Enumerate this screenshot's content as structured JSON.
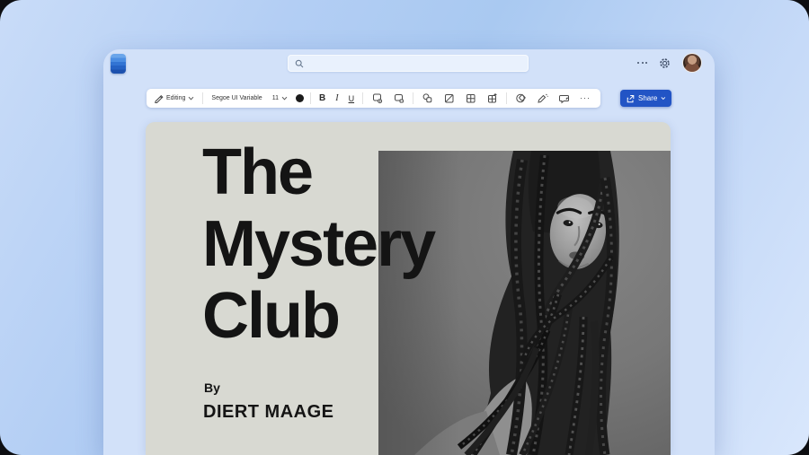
{
  "window": {
    "topbar": {
      "search": {
        "placeholder": "",
        "icon": "search-icon"
      },
      "right_icons": [
        "more-horizontal-icon",
        "settings-gear-icon",
        "user-avatar"
      ]
    },
    "toolbar": {
      "mode_label": "Editing",
      "font_family": "Segoe UI Variable",
      "font_size": "11",
      "text_color_swatch": "#1b1b1b",
      "bold_label": "B",
      "italic_label": "I",
      "underline_label": "U",
      "more_glyph": "···",
      "icons": [
        "pencil-icon",
        "chevron-down-icon",
        "styles-icon",
        "format-painter-icon",
        "shapes-icon",
        "image-icon",
        "table-icon",
        "table-add-icon",
        "designer-icon",
        "ink-pen-icon",
        "comments-icon",
        "more-options-icon"
      ]
    },
    "share": {
      "label": "Share",
      "color": "#2254C5",
      "icon": "share-icon"
    }
  },
  "document": {
    "background": "#D8D9D2",
    "title_lines": [
      "The",
      "Mystery",
      "Club"
    ],
    "byline_prefix": "By",
    "author": "DIERT MAAGE",
    "photo_description": "grayscale portrait of woman with long braids"
  },
  "colors": {
    "desktop_gradient": [
      "#C9DCF8",
      "#A9C9F1",
      "#D9E7FC"
    ],
    "window_bg": "#D2E1F9",
    "accent_blue": "#2254C5",
    "doc_text": "#141414"
  }
}
